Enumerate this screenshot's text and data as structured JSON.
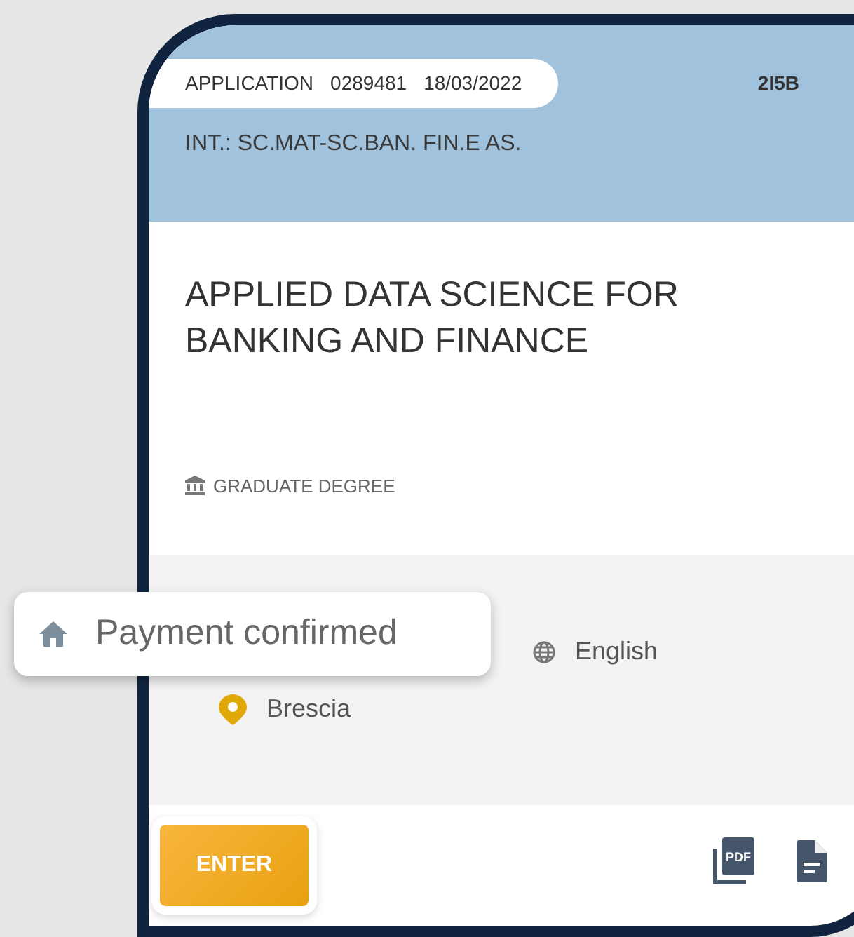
{
  "header": {
    "application_label": "APPLICATION",
    "application_number": "0289481",
    "application_date": "18/03/2022",
    "code": "2I5B",
    "subtitle": "INT.: SC.MAT-SC.BAN. FIN.E AS."
  },
  "course": {
    "title": "APPLIED DATA SCIENCE FOR BANKING AND FINANCE",
    "degree": "GRADUATE DEGREE"
  },
  "details": {
    "language": "English",
    "location": "Brescia"
  },
  "toast": {
    "text": "Payment confirmed"
  },
  "footer": {
    "enter_button": "ENTER",
    "pdf_icon_label": "PDF"
  }
}
